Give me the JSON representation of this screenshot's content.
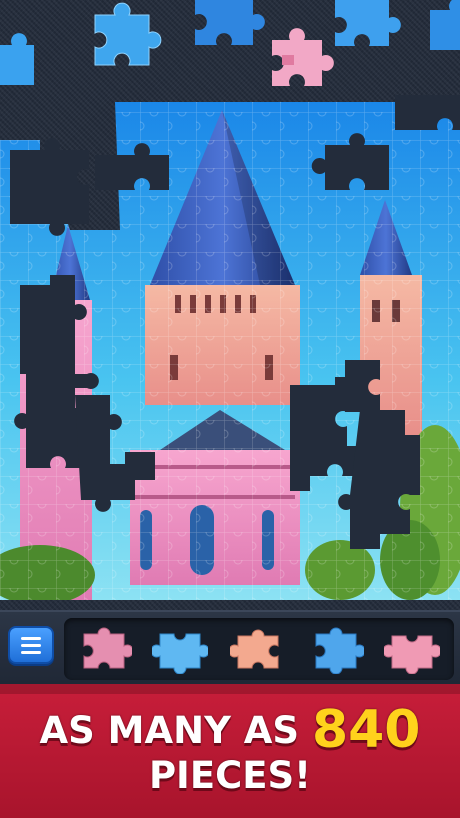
{
  "banner": {
    "line1_prefix": "AS MANY AS",
    "line1_number": "840",
    "line2": "PIECES!"
  },
  "tray": {
    "menu_icon": "hamburger-menu-icon",
    "pieces": [
      {
        "icon": "puzzle-piece-icon",
        "color": "#e58fb0"
      },
      {
        "icon": "puzzle-piece-icon",
        "color": "#5fb8f2"
      },
      {
        "icon": "puzzle-piece-icon",
        "color": "#f3a98f"
      },
      {
        "icon": "puzzle-piece-icon",
        "color": "#4fa6ec"
      },
      {
        "icon": "puzzle-piece-icon",
        "color": "#f09ab4"
      }
    ]
  },
  "colors": {
    "board_background": "#232c3b",
    "banner_red": "#c81e3a",
    "highlight_yellow": "#ffd21c",
    "menu_blue": "#2a86ee"
  }
}
